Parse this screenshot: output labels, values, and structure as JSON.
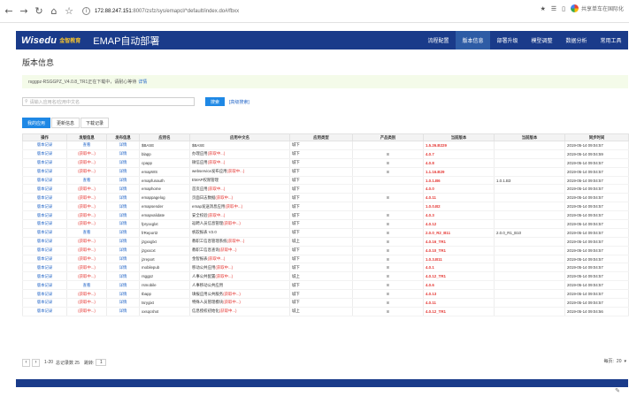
{
  "browser": {
    "host": "172.88.247.151",
    "path": ":8007/zsfz/sys/emapcl/*default/index.do#/fbxx",
    "profile_label": "共享单车在国际化"
  },
  "app": {
    "logo": "Wisedu",
    "logo_cn": "金智教育",
    "title": "EMAP自动部署",
    "nav": [
      "流程配置",
      "版本信息",
      "部署升级",
      "模型调整",
      "数据分析",
      "常用工具"
    ],
    "active_nav": 1
  },
  "page_title": "版本信息",
  "notice": {
    "text": "rsggpz-RSGGPZ_V4.0.8_TR1正在下载中，请耐心等待",
    "link": "详情"
  },
  "search": {
    "placeholder": "请输入应用名/应用中文名",
    "button": "搜索",
    "advanced": "[高级搜索]"
  },
  "tabs": [
    "我的应用",
    "更新信息",
    "下载记录"
  ],
  "table": {
    "columns": [
      "操作",
      "发版信息",
      "发布信息",
      "应用名",
      "应用中文名",
      "应用类型",
      "产品类别",
      "当前版本",
      "当前版本",
      "同步时间"
    ],
    "rows": [
      [
        "版本记录",
        "查看",
        "详情",
        "$BASE",
        "$BASE",
        "城下",
        "",
        "1.5.26.B229",
        "",
        "2019-05-14 09:04:57"
      ],
      [
        "版本记录",
        "(获取中...)",
        "详情",
        "blapp",
        "办理应用(获取中...)",
        "城下",
        "8",
        "4.0.7",
        "",
        "2019-05-14 09:04:59"
      ],
      [
        "版本记录",
        "(获取中...)",
        "详情",
        "cpapp",
        "微信应用(获取中...)",
        "城下",
        "8",
        "4.0.8",
        "",
        "2019-05-14 09:04:57"
      ],
      [
        "版本记录",
        "(获取中...)",
        "详情",
        "emapWS",
        "webservice发布应用(获取中...)",
        "城下",
        "8",
        "1.1.16.B29",
        "",
        "2019-05-14 09:04:57"
      ],
      [
        "版本记录",
        "查看",
        "详情",
        "emapfunauth",
        "EMAP权限管理",
        "城下",
        "",
        "1.0.1.B6",
        "1.0.1.B3",
        "2019-05-14 09:04:57"
      ],
      [
        "版本记录",
        "(获取中...)",
        "详情",
        "emaphome",
        "首页应用(获取中...)",
        "城下",
        "",
        "4.0.0",
        "",
        "2019-05-14 09:04:57"
      ],
      [
        "版本记录",
        "(获取中...)",
        "详情",
        "emappagelog",
        "页面日志数据(获取中...)",
        "城下",
        "8",
        "4.0.11",
        "",
        "2019-05-14 09:04:57"
      ],
      [
        "版本记录",
        "(获取中...)",
        "详情",
        "emapsender",
        "emap发送消息应用(获取中...)",
        "城下",
        "",
        "1.0.0.B2",
        "",
        "2019-05-14 09:04:57"
      ],
      [
        "版本记录",
        "(获取中...)",
        "详情",
        "emapvalidate",
        "安全校验(获取中...)",
        "城下",
        "8",
        "4.0.3",
        "",
        "2019-05-14 09:04:57"
      ],
      [
        "版本记录",
        "(获取中...)",
        "详情",
        "fpryxxglxt",
        "返聘人员信息管理(获取中...)",
        "城下",
        "8",
        "4.0.12",
        "",
        "2019-05-14 09:04:57"
      ],
      [
        "版本记录",
        "查看",
        "详情",
        "frReport2",
        "帆软报表 V2.0",
        "城下",
        "8",
        "2.0.0_R2_B11",
        "2.0.0_R1_B10",
        "2019-05-14 09:04:57"
      ],
      [
        "版本记录",
        "(获取中...)",
        "详情",
        "jzgxxglxt",
        "教职工信息管理系统(获取中...)",
        "城上",
        "8",
        "4.0.16_TR1",
        "",
        "2019-05-14 09:04:57"
      ],
      [
        "版本记录",
        "(获取中...)",
        "详情",
        "jzgxxcxt",
        "教职工信息查询(获取中...)",
        "城下",
        "8",
        "4.0.10_TR1",
        "",
        "2019-05-14 09:04:57"
      ],
      [
        "版本记录",
        "(获取中...)",
        "详情",
        "jzreport",
        "金智报表(获取中...)",
        "城下",
        "8",
        "1.0.3.B11",
        "",
        "2019-05-14 09:04:57"
      ],
      [
        "版本记录",
        "(获取中...)",
        "详情",
        "mobilepub",
        "移动公共应用(获取中...)",
        "城下",
        "8",
        "4.0.1",
        "",
        "2019-05-14 09:04:57"
      ],
      [
        "版本记录",
        "(获取中...)",
        "详情",
        "rsggpz",
        "人事公共配置(获取中...)",
        "城上",
        "8",
        "4.0.12_TR1",
        "",
        "2019-05-14 09:04:57"
      ],
      [
        "版本记录",
        "查看",
        "详情",
        "rsmobile",
        "人事移动公共应用",
        "城下",
        "8",
        "4.0.6",
        "",
        "2019-05-14 09:04:57"
      ],
      [
        "版本记录",
        "(获取中...)",
        "详情",
        "tbapp",
        "填报应用公共服务(获取中...)",
        "城下",
        "8",
        "4.0.13",
        "",
        "2019-05-14 09:04:57"
      ],
      [
        "版本记录",
        "(获取中...)",
        "详情",
        "tsrygixt",
        "特殊人员管理模块(获取中...)",
        "城下",
        "8",
        "4.0.11",
        "",
        "2019-05-14 09:04:57"
      ],
      [
        "版本记录",
        "(获取中...)",
        "详情",
        "xxsqcshxt",
        "信息授权初始化(获取中...)",
        "城上",
        "8",
        "4.0.12_TR1",
        "",
        "2019-05-14 09:04:56"
      ]
    ]
  },
  "pager": {
    "range": "1-20",
    "total_label": "总记录数 25",
    "goto_label": "跳转:",
    "page": "1",
    "per_page_label": "每页:",
    "per_page": "20"
  },
  "colors": {
    "header_bg": "#1a3b8a",
    "nav_active": "#2e5ca5",
    "primary": "#1e88e5",
    "link": "#2466c7",
    "red": "#e53935",
    "notice_bg": "#f4fbe9"
  }
}
